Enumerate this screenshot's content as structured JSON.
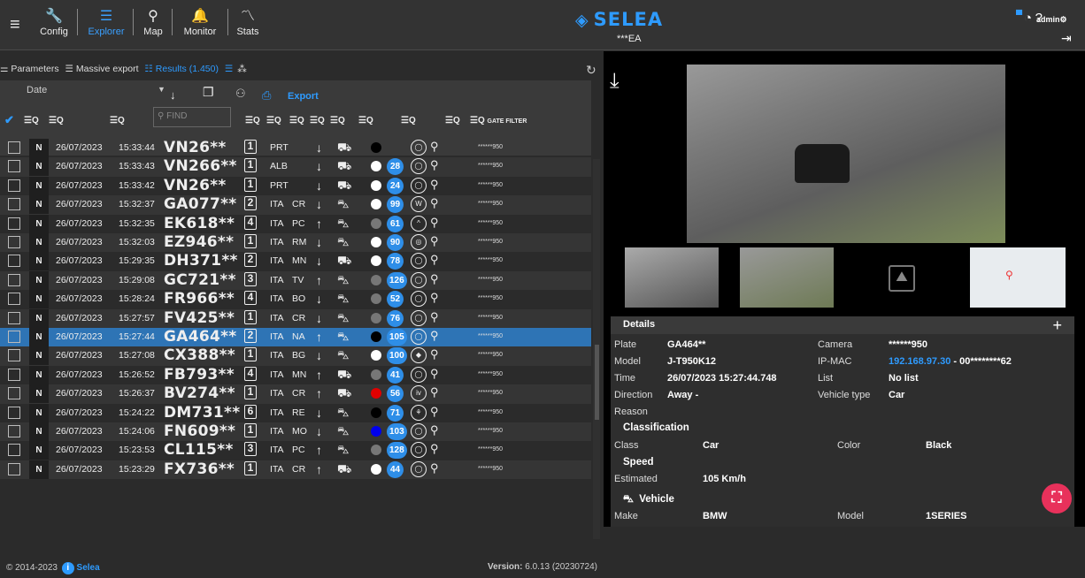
{
  "nav": {
    "items": [
      {
        "label": "Config",
        "icon": "wrench-icon"
      },
      {
        "label": "Explorer",
        "icon": "list-search-icon"
      },
      {
        "label": "Map",
        "icon": "map-pin-icon"
      },
      {
        "label": "Monitor",
        "icon": "bell-icon"
      },
      {
        "label": "Stats",
        "icon": "chart-icon"
      }
    ],
    "logo": "SELEA",
    "site": "***EA",
    "user": "admin"
  },
  "toolbar": {
    "tabs": [
      "Parameters",
      "Massive export",
      "Results (1.450)"
    ],
    "sort_field": "Date",
    "export_label": "Export",
    "find_placeholder": "FIND",
    "gate_filter_label": "GATE FILTER"
  },
  "rows": [
    {
      "date": "26/07/2023",
      "time": "15:33:44",
      "plate": "VN26**",
      "lane": "1",
      "country": "PRT",
      "province": "",
      "dir": "↓",
      "vehicle": "⛟",
      "color": "#000000",
      "speed": "",
      "brand": "◯",
      "gate": "******950"
    },
    {
      "date": "26/07/2023",
      "time": "15:33:43",
      "plate": "VN266**",
      "lane": "1",
      "country": "ALB",
      "province": "",
      "dir": "↓",
      "vehicle": "⛟",
      "color": "#ffffff",
      "speed": "28",
      "brand": "◯",
      "gate": "******950"
    },
    {
      "date": "26/07/2023",
      "time": "15:33:42",
      "plate": "VN26**",
      "lane": "1",
      "country": "PRT",
      "province": "",
      "dir": "↓",
      "vehicle": "⛟",
      "color": "#ffffff",
      "speed": "24",
      "brand": "◯",
      "gate": "******950"
    },
    {
      "date": "26/07/2023",
      "time": "15:32:37",
      "plate": "GA077**",
      "lane": "2",
      "country": "ITA",
      "province": "CR",
      "dir": "↓",
      "vehicle": "⛍",
      "color": "#ffffff",
      "speed": "99",
      "brand": "W",
      "gate": "******950"
    },
    {
      "date": "26/07/2023",
      "time": "15:32:35",
      "plate": "EK618**",
      "lane": "4",
      "country": "ITA",
      "province": "PC",
      "dir": "↑",
      "vehicle": "⛍",
      "color": "#777777",
      "speed": "61",
      "brand": "^",
      "gate": "******950"
    },
    {
      "date": "26/07/2023",
      "time": "15:32:03",
      "plate": "EZ946**",
      "lane": "1",
      "country": "ITA",
      "province": "RM",
      "dir": "↓",
      "vehicle": "⛍",
      "color": "#ffffff",
      "speed": "90",
      "brand": "◎",
      "gate": "******950"
    },
    {
      "date": "26/07/2023",
      "time": "15:29:35",
      "plate": "DH371**",
      "lane": "2",
      "country": "ITA",
      "province": "MN",
      "dir": "↓",
      "vehicle": "⛟",
      "color": "#ffffff",
      "speed": "78",
      "brand": "◯",
      "gate": "******950"
    },
    {
      "date": "26/07/2023",
      "time": "15:29:08",
      "plate": "GC721**",
      "lane": "3",
      "country": "ITA",
      "province": "TV",
      "dir": "↑",
      "vehicle": "⛍",
      "color": "#777777",
      "speed": "126",
      "brand": "◯",
      "gate": "******950"
    },
    {
      "date": "26/07/2023",
      "time": "15:28:24",
      "plate": "FR966**",
      "lane": "4",
      "country": "ITA",
      "province": "BO",
      "dir": "↓",
      "vehicle": "⛍",
      "color": "#777777",
      "speed": "52",
      "brand": "◯",
      "gate": "******950"
    },
    {
      "date": "26/07/2023",
      "time": "15:27:57",
      "plate": "FV425**",
      "lane": "1",
      "country": "ITA",
      "province": "CR",
      "dir": "↓",
      "vehicle": "⛍",
      "color": "#777777",
      "speed": "76",
      "brand": "◯",
      "gate": "******950"
    },
    {
      "date": "26/07/2023",
      "time": "15:27:44",
      "plate": "GA464**",
      "lane": "2",
      "country": "ITA",
      "province": "NA",
      "dir": "↑",
      "vehicle": "⛍",
      "color": "#000000",
      "speed": "105",
      "brand": "◯",
      "gate": "******950",
      "selected": true
    },
    {
      "date": "26/07/2023",
      "time": "15:27:08",
      "plate": "CX388**",
      "lane": "1",
      "country": "ITA",
      "province": "BG",
      "dir": "↓",
      "vehicle": "⛍",
      "color": "#ffffff",
      "speed": "100",
      "brand": "◆",
      "gate": "******950"
    },
    {
      "date": "26/07/2023",
      "time": "15:26:52",
      "plate": "FB793**",
      "lane": "4",
      "country": "ITA",
      "province": "MN",
      "dir": "↑",
      "vehicle": "⛟",
      "color": "#777777",
      "speed": "41",
      "brand": "◯",
      "gate": "******950"
    },
    {
      "date": "26/07/2023",
      "time": "15:26:37",
      "plate": "BV274**",
      "lane": "1",
      "country": "ITA",
      "province": "CR",
      "dir": "↑",
      "vehicle": "⛟",
      "color": "#e00000",
      "speed": "56",
      "brand": "iv",
      "gate": "******950"
    },
    {
      "date": "26/07/2023",
      "time": "15:24:22",
      "plate": "DM731**",
      "lane": "6",
      "country": "ITA",
      "province": "RE",
      "dir": "↓",
      "vehicle": "⛍",
      "color": "#000000",
      "speed": "71",
      "brand": "⚘",
      "gate": "******950"
    },
    {
      "date": "26/07/2023",
      "time": "15:24:06",
      "plate": "FN609**",
      "lane": "1",
      "country": "ITA",
      "province": "MO",
      "dir": "↓",
      "vehicle": "⛍",
      "color": "#0000ee",
      "speed": "103",
      "brand": "◯",
      "gate": "******950"
    },
    {
      "date": "26/07/2023",
      "time": "15:23:53",
      "plate": "CL115**",
      "lane": "3",
      "country": "ITA",
      "province": "PC",
      "dir": "↑",
      "vehicle": "⛍",
      "color": "#777777",
      "speed": "128",
      "brand": "◯",
      "gate": "******950"
    },
    {
      "date": "26/07/2023",
      "time": "15:23:29",
      "plate": "FX736**",
      "lane": "1",
      "country": "ITA",
      "province": "CR",
      "dir": "↑",
      "vehicle": "⛟",
      "color": "#ffffff",
      "speed": "44",
      "brand": "◯",
      "gate": "******950"
    }
  ],
  "footer": {
    "copyright": "© 2014-2023",
    "company": "Selea",
    "version_label": "Version:",
    "version": "6.0.13 (20230724)"
  },
  "details": {
    "title": "Details",
    "plate_k": "Plate",
    "plate_v": "GA464**",
    "camera_k": "Camera",
    "camera_v": "******950",
    "model_k": "Model",
    "model_v": "J-T950K12",
    "ipmac_k": "IP-MAC",
    "ip_v": "192.168.97.30",
    "mac_v": " - 00********62",
    "time_k": "Time",
    "time_v": "26/07/2023 15:27:44.748",
    "list_k": "List",
    "list_v": "No list",
    "direction_k": "Direction",
    "direction_v": "Away -",
    "vtype_k": "Vehicle type",
    "vtype_v": "Car",
    "reason_k": "Reason",
    "classification": "Classification",
    "class_k": "Class",
    "class_v": "Car",
    "color_k": "Color",
    "color_v": "Black",
    "speed_section": "Speed",
    "estimated_k": "Estimated",
    "estimated_v": "105 Km/h",
    "vehicle_section": "Vehicle",
    "make_k": "Make",
    "make_v": "BMW",
    "vmodel_k": "Model",
    "vmodel_v": "1SERIES"
  },
  "colors": {
    "accent": "#2e9bff",
    "selected_row": "#2e74b5",
    "fab": "#e8315b"
  }
}
